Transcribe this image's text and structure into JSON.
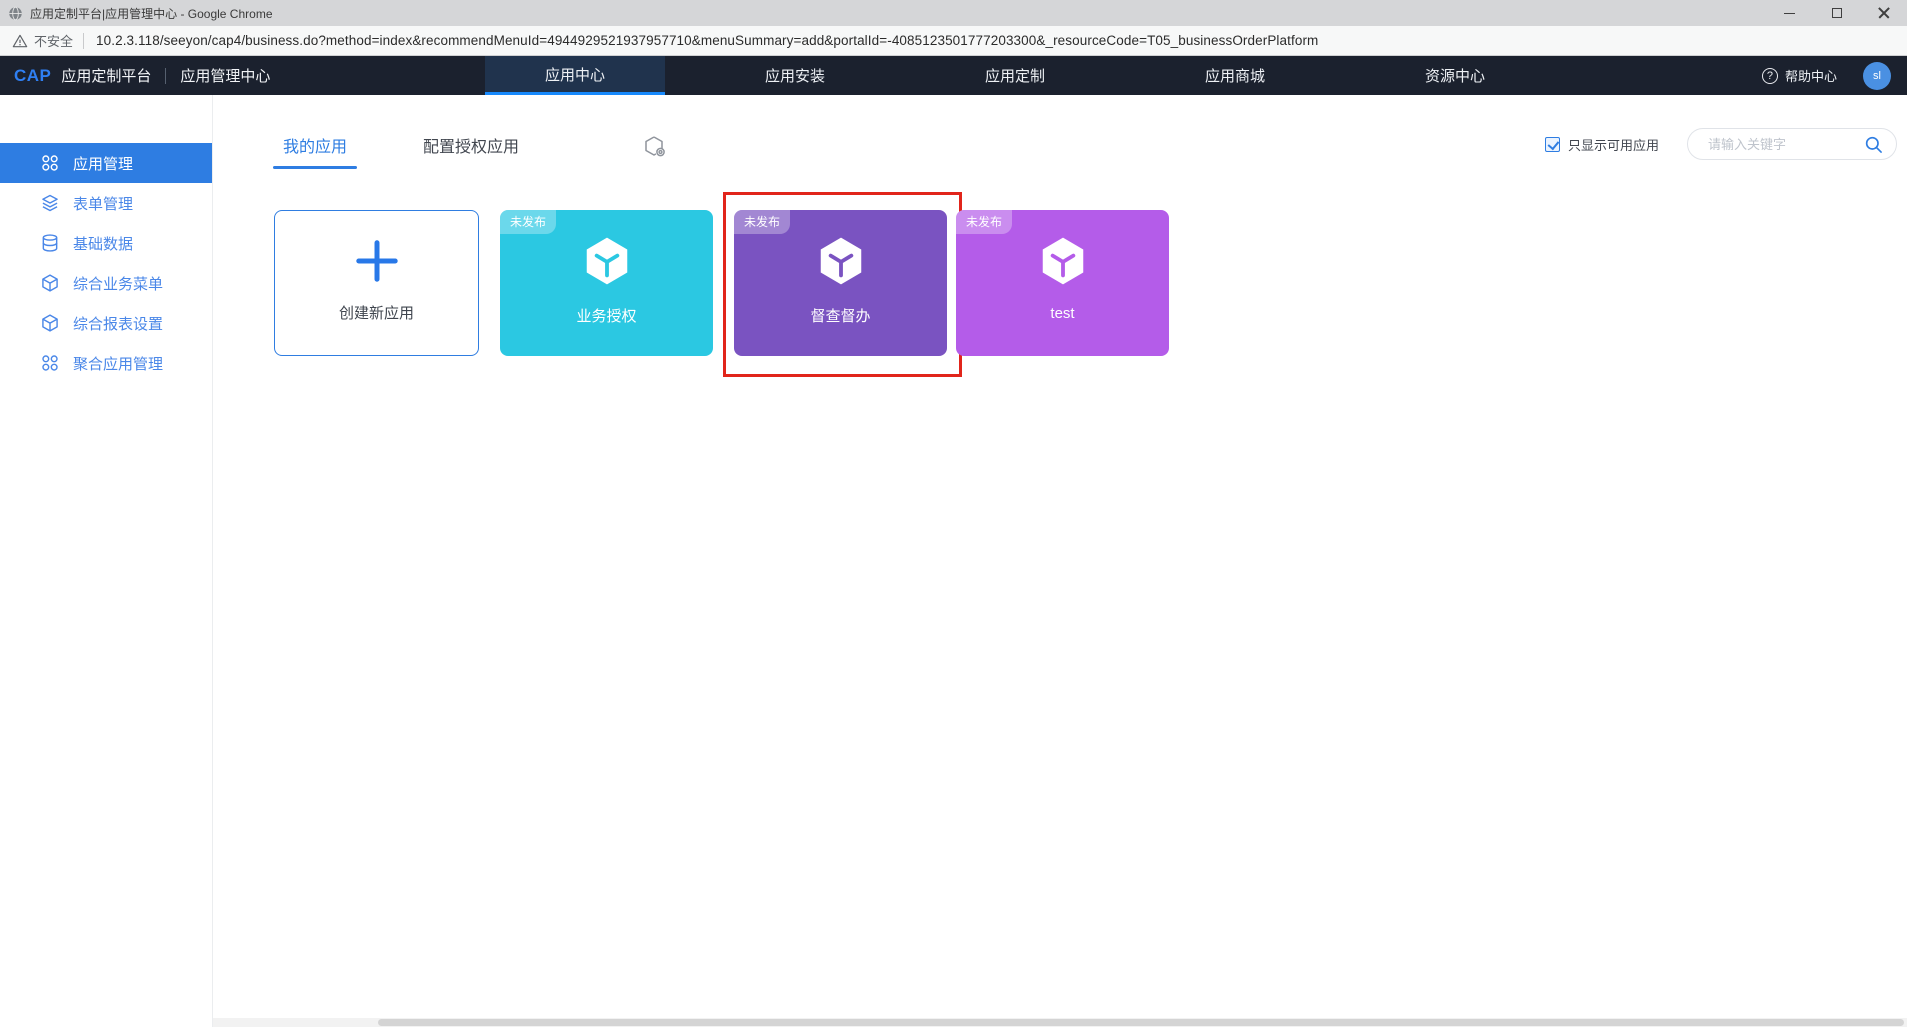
{
  "browser": {
    "window_title": "应用定制平台|应用管理中心 - Google Chrome",
    "security_label": "不安全",
    "url": "10.2.3.118/seeyon/cap4/business.do?method=index&recommendMenuId=4944929521937957710&menuSummary=add&portalId=-4085123501777203300&_resourceCode=T05_businessOrderPlatform"
  },
  "topnav": {
    "logo_text": "CAP",
    "product_name": "应用定制平台",
    "module_name": "应用管理中心",
    "tabs": [
      {
        "label": "应用中心",
        "active": true
      },
      {
        "label": "应用安装",
        "active": false
      },
      {
        "label": "应用定制",
        "active": false
      },
      {
        "label": "应用商城",
        "active": false
      },
      {
        "label": "资源中心",
        "active": false
      }
    ],
    "help_icon": "?",
    "help_label": "帮助中心",
    "avatar_text": "sl"
  },
  "sidebar": {
    "items": [
      {
        "label": "应用管理",
        "icon": "app-grid-icon",
        "active": true
      },
      {
        "label": "表单管理",
        "icon": "layers-icon",
        "active": false
      },
      {
        "label": "基础数据",
        "icon": "database-icon",
        "active": false
      },
      {
        "label": "综合业务菜单",
        "icon": "cube-icon",
        "active": false
      },
      {
        "label": "综合报表设置",
        "icon": "cube-icon",
        "active": false
      },
      {
        "label": "聚合应用管理",
        "icon": "app-grid-icon",
        "active": false
      }
    ]
  },
  "content": {
    "tabs": [
      {
        "label": "我的应用",
        "active": true
      },
      {
        "label": "配置授权应用",
        "active": false
      }
    ],
    "filter": {
      "label": "只显示可用应用",
      "checked": true
    },
    "search": {
      "placeholder": "请输入关键字"
    },
    "cards": [
      {
        "type": "create",
        "label": "创建新应用"
      },
      {
        "type": "app",
        "label": "业务授权",
        "badge": "未发布",
        "color": "#2bc8e2",
        "highlighted": false
      },
      {
        "type": "app",
        "label": "督查督办",
        "badge": "未发布",
        "color": "#7a53c1",
        "highlighted": true
      },
      {
        "type": "app",
        "label": "test",
        "badge": "未发布",
        "color": "#b45ce9",
        "highlighted": false
      }
    ]
  },
  "colors": {
    "accent_blue": "#2e7de2",
    "nav_bg": "#1b212e",
    "nav_active_bg": "#20334d",
    "nav_underline": "#1789fc",
    "card_cyan": "#2bc8e2",
    "card_purple": "#7a53c1",
    "card_violet": "#b45ce9",
    "annotation_red": "#e1251b"
  }
}
